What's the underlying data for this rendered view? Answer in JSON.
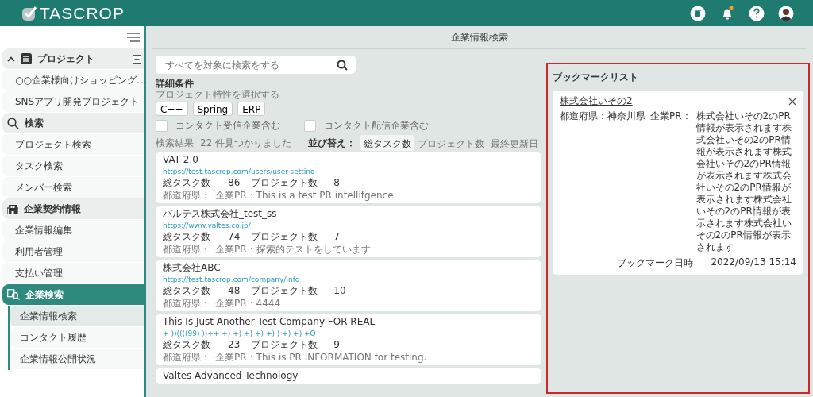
{
  "header": {
    "logo": "TASCROP"
  },
  "sidebar": {
    "sections": [
      {
        "label": "プロジェクト",
        "selected": false,
        "items": [
          {
            "label": "○○企業様向けショッピング…",
            "selected": false
          },
          {
            "label": "SNSアプリ開発プロジェクト",
            "selected": false
          }
        ]
      },
      {
        "label": "検索",
        "selected": false,
        "items": [
          {
            "label": "プロジェクト検索",
            "selected": false
          },
          {
            "label": "タスク検索",
            "selected": false
          },
          {
            "label": "メンバー検索",
            "selected": false
          }
        ]
      },
      {
        "label": "企業契約情報",
        "selected": false,
        "items": [
          {
            "label": "企業情報編集",
            "selected": false
          },
          {
            "label": "利用者管理",
            "selected": false
          },
          {
            "label": "支払い管理",
            "selected": false
          }
        ]
      },
      {
        "label": "企業検索",
        "selected": true,
        "items": [
          {
            "label": "企業情報検索",
            "selected": true
          },
          {
            "label": "コンタクト履歴",
            "selected": false
          },
          {
            "label": "企業情報公開状況",
            "selected": false
          }
        ]
      }
    ]
  },
  "page_title": "企業情報検索",
  "search": {
    "placeholder": "すべてを対象に検索をする"
  },
  "filters": {
    "heading": "詳細条件",
    "subheading": "プロジェクト特性を選択する",
    "tags": [
      "C++",
      "Spring",
      "ERP"
    ],
    "checkboxes": [
      {
        "label": "コンタクト受信企業含む",
        "checked": false
      },
      {
        "label": "コンタクト配信企業含む",
        "checked": false
      }
    ]
  },
  "results_label": "検索結果",
  "results_count": "22 件見つかりました",
  "sort": {
    "label": "並び替え：",
    "options": [
      {
        "label": "総タスク数",
        "selected": true
      },
      {
        "label": "プロジェクト数",
        "selected": false
      },
      {
        "label": "最終更新日",
        "selected": false
      }
    ]
  },
  "results": [
    {
      "title": "VAT 2.0",
      "url": "https://test.tascrop.com/users/user-setting",
      "tasks_label": "総タスク数",
      "tasks": "86",
      "projects_label": "プロジェクト数",
      "projects": "8",
      "pref": "都道府県：",
      "pr": "企業PR：This is a test PR intellifgence"
    },
    {
      "title": "バルテス株式会社_test_ss",
      "url": "https://www.valtes.co.jp/",
      "tasks_label": "総タスク数",
      "tasks": "74",
      "projects_label": "プロジェクト数",
      "projects": "7",
      "pref": "都道府県：",
      "pr": "企業PR：探索的テストをしています"
    },
    {
      "title": "株式会社ABC",
      "url": "https://test.tascrop.com/company/info",
      "tasks_label": "総タスク数",
      "tasks": "48",
      "projects_label": "プロジェクト数",
      "projects": "10",
      "pref": "都道府県：",
      "pr": "企業PR：4444"
    },
    {
      "title": "This Is Just Another Test Company FOR REAL",
      "url": "+ ))((((99) ))++ +) +) +) +) +) ) +) +) +Q",
      "tasks_label": "総タスク数",
      "tasks": "23",
      "projects_label": "プロジェクト数",
      "projects": "9",
      "pref": "都道府県：",
      "pr": "企業PR：This is PR INFORMATION for testing."
    },
    {
      "title": "Valtes Advanced Technology"
    }
  ],
  "bookmarks": {
    "heading": "ブックマークリスト",
    "items": [
      {
        "title": "株式会社いその2",
        "pref": "都道府県：神奈川県",
        "pr_label": "企業PR：",
        "pr": "株式会社いその2のPR情報が表示されます株式会社いその2のPR情報が表示されます株式会社いその2のPR情報が表示されます株式会社いその2のPR情報が表示されます株式会社いその2のPR情報が表示されます株式会社いその2のPR情報が表示されます",
        "date_label": "ブックマーク日時",
        "date": "2022/09/13 15:14"
      }
    ]
  }
}
